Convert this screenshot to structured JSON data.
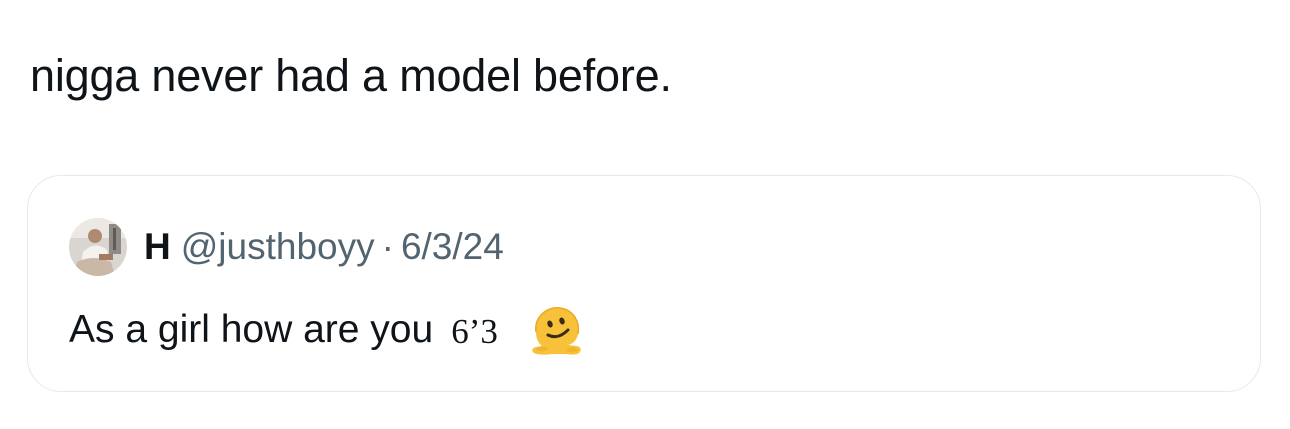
{
  "tweet": {
    "text": "nigga never had a model before."
  },
  "quoted_tweet": {
    "display_name": "H",
    "handle": "@justhboyy",
    "separator": "·",
    "date": "6/3/24",
    "text": "As a girl how are you",
    "height_text": "6’3",
    "emoji": "melting-face-icon"
  },
  "colors": {
    "primary_text": "#0f1419",
    "secondary_text": "#536471",
    "card_border": "#e6e9ec",
    "emoji_yellow": "#f7c23a"
  }
}
